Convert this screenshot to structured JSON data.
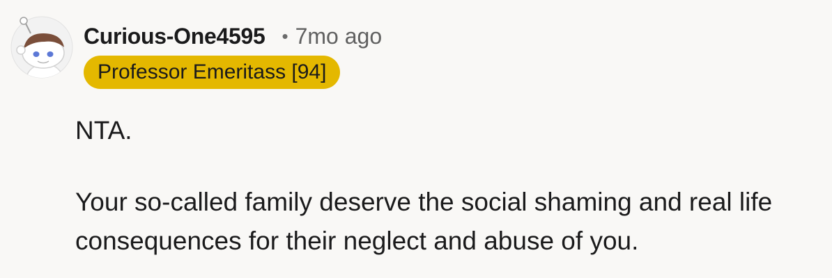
{
  "comment": {
    "author": "Curious-One4595",
    "separator": "•",
    "timestamp": "7mo ago",
    "flair": "Professor Emeritass [94]",
    "avatar_icon": "reddit-snoo-avatar-icon",
    "paragraphs": [
      "NTA.",
      "Your so-called family deserve the social shaming and real life consequences for their neglect and abuse of you."
    ]
  },
  "colors": {
    "background": "#f9f8f6",
    "flair_bg": "#e4b800",
    "text": "#1a1a1b",
    "meta_text": "#606060"
  }
}
